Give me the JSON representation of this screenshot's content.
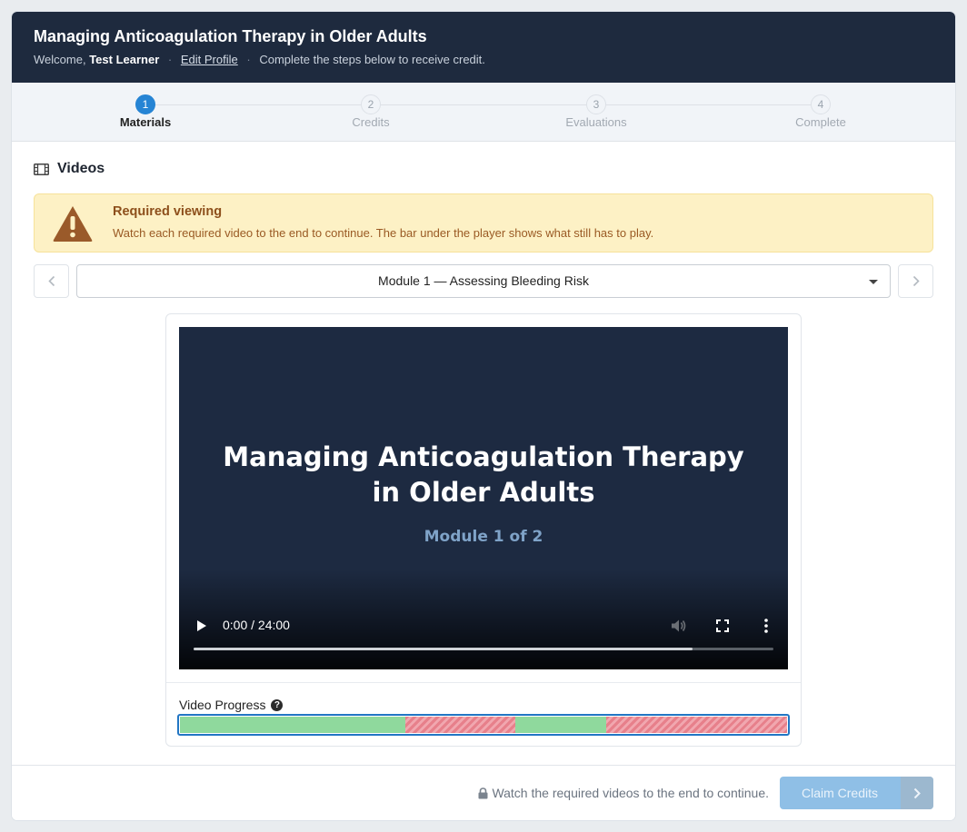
{
  "header": {
    "title": "Managing Anticoagulation Therapy in Older Adults",
    "welcome_prefix": "Welcome,",
    "user_name": "Test Learner",
    "edit_profile": "Edit Profile",
    "instruction": "Complete the steps below to receive credit."
  },
  "steps": [
    {
      "num": "1",
      "label": "Materials",
      "state": "active"
    },
    {
      "num": "2",
      "label": "Credits",
      "state": "inactive"
    },
    {
      "num": "3",
      "label": "Evaluations",
      "state": "inactive"
    },
    {
      "num": "4",
      "label": "Complete",
      "state": "inactive"
    }
  ],
  "section": {
    "title": "Videos",
    "icon": "film-icon"
  },
  "alert": {
    "title": "Required viewing",
    "text": "Watch each required video to the end to continue. The bar under the player shows what still has to play.",
    "icon": "warning-triangle-icon"
  },
  "module_select": {
    "selected": "Module 1 — Assessing Bleeding Risk"
  },
  "video": {
    "title_line1": "Managing Anticoagulation Therapy",
    "title_line2": "in Older Adults",
    "subtitle": "Module 1 of 2",
    "time": "0:00 / 24:00",
    "buffered_fraction": 0.86
  },
  "progress": {
    "label": "Video Progress",
    "help_icon": "question-circle-icon",
    "segments": [
      {
        "status": "watched",
        "fraction": 0.372
      },
      {
        "status": "unwatched",
        "fraction": 0.181
      },
      {
        "status": "watched",
        "fraction": 0.149
      },
      {
        "status": "unwatched",
        "fraction": 0.298
      }
    ]
  },
  "footer": {
    "message": "Watch the required videos to the end to continue.",
    "claim_label": "Claim Credits"
  },
  "colors": {
    "header_bg": "#1e2a3e",
    "accent": "#2684d4",
    "watched": "#8fd99d",
    "unwatched": "#e7808b",
    "alert_bg": "#fdf1c5"
  }
}
